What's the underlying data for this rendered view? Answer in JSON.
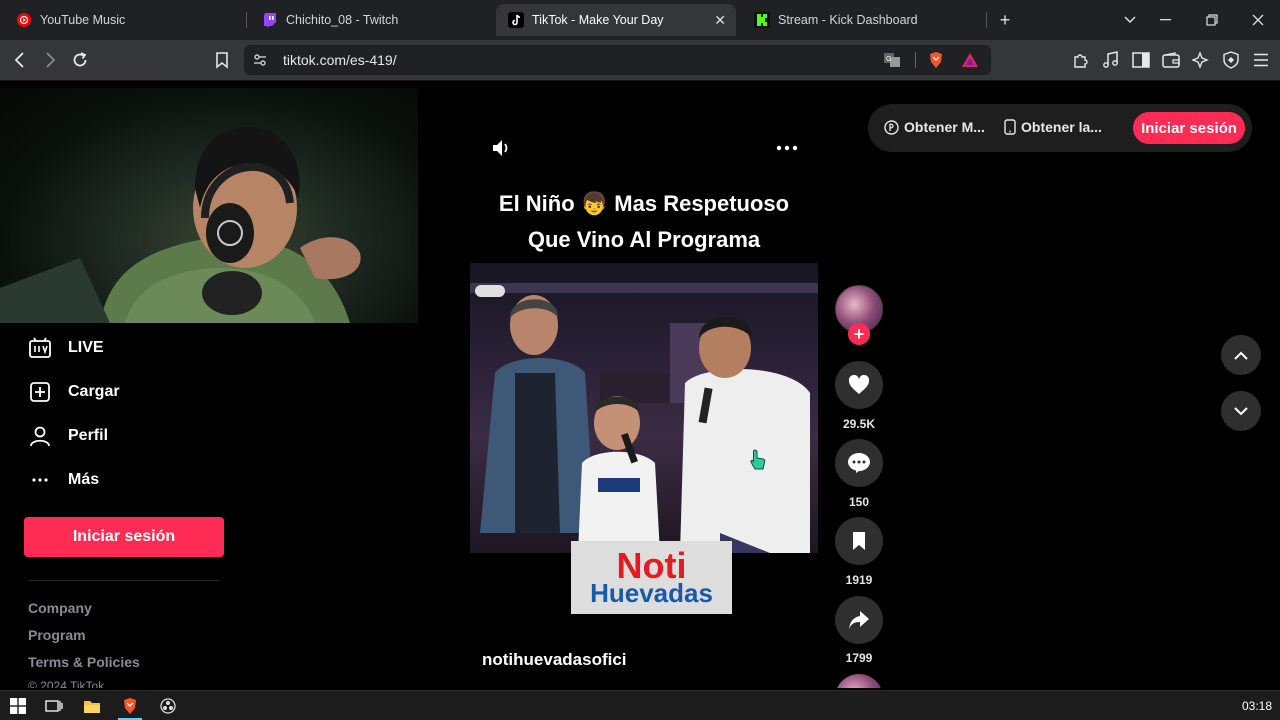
{
  "browser": {
    "tabs": [
      {
        "title": "YouTube Music",
        "active": false
      },
      {
        "title": "Chichito_08 - Twitch",
        "active": false
      },
      {
        "title": "TikTok - Make Your Day",
        "active": true
      },
      {
        "title": "Stream - Kick Dashboard",
        "active": false
      }
    ],
    "url": "tiktok.com/es-419/"
  },
  "sidebar": {
    "items": [
      {
        "label": "LIVE",
        "icon": "live-icon"
      },
      {
        "label": "Cargar",
        "icon": "upload-icon"
      },
      {
        "label": "Perfil",
        "icon": "profile-icon"
      },
      {
        "label": "Más",
        "icon": "more-icon"
      }
    ],
    "login_label": "Iniciar sesión",
    "footer": [
      "Company",
      "Program",
      "Terms & Policies",
      "© 2024 TikTok"
    ]
  },
  "header": {
    "link1": "Obtener M...",
    "link2": "Obtener la...",
    "login_label": "Iniciar sesión"
  },
  "video": {
    "title_line1": "El Niño 👦 Mas Respetuoso",
    "title_line2": "Que Vino Al Programa",
    "logo_line1": "Noti",
    "logo_line2": "Huevadas",
    "author": "notihuevadasofici"
  },
  "actions": {
    "likes": "29.5K",
    "comments": "150",
    "saves": "1919",
    "shares": "1799"
  },
  "taskbar": {
    "time": "03:18"
  },
  "colors": {
    "accent": "#fe2c55",
    "background": "#000000",
    "chrome": "#202124"
  }
}
